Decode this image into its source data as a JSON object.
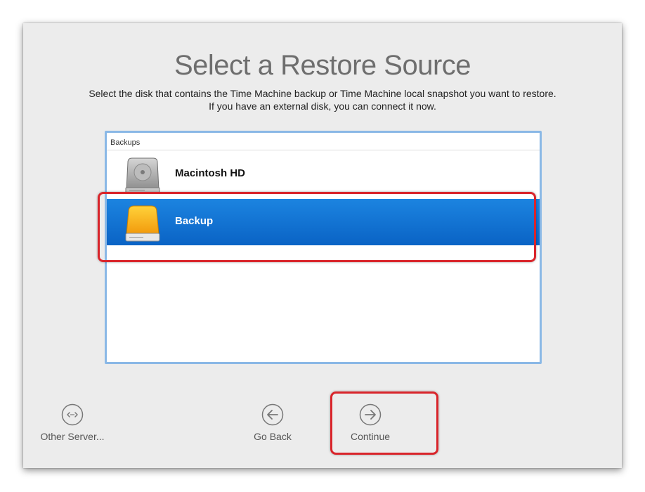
{
  "title": "Select a Restore Source",
  "subtitle": "Select the disk that contains the Time Machine backup or Time Machine local snapshot you want to restore. If you have an external disk, you can connect it now.",
  "source_list": {
    "header": "Backups",
    "items": [
      {
        "label": "Macintosh HD",
        "icon": "internal-disk-icon",
        "selected": false
      },
      {
        "label": "Backup",
        "icon": "external-disk-icon",
        "selected": true
      }
    ]
  },
  "buttons": {
    "other_server": {
      "label": "Other Server...",
      "icon": "network-icon"
    },
    "go_back": {
      "label": "Go Back",
      "icon": "arrow-left-circle-icon"
    },
    "continue": {
      "label": "Continue",
      "icon": "arrow-right-circle-icon"
    }
  },
  "colors": {
    "selection": "#0a63c5",
    "annotation": "#d9252b",
    "list_border": "#8ab8e6"
  }
}
